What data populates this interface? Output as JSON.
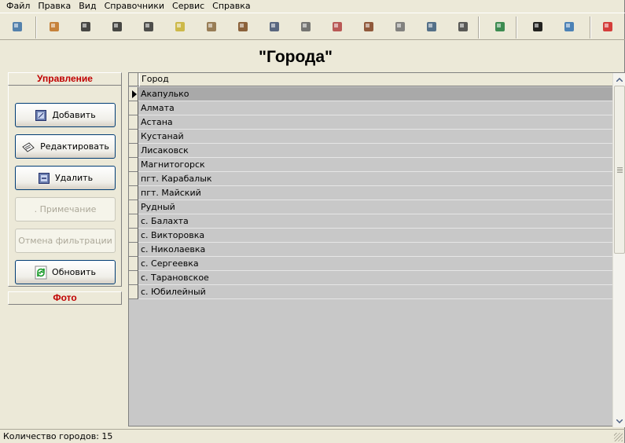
{
  "menu": [
    "Файл",
    "Правка",
    "Вид",
    "Справочники",
    "Сервис",
    "Справка"
  ],
  "toolbar": {
    "buttons": [
      {
        "name": "exit-icon",
        "color": "#3a6ea5"
      },
      {
        "name": "image-icon",
        "color": "#c07020"
      },
      {
        "name": "users-icon",
        "color": "#2a2a2a"
      },
      {
        "name": "person-edit-icon",
        "color": "#2a2a2a"
      },
      {
        "name": "person-list-icon",
        "color": "#333"
      },
      {
        "name": "folder-icon",
        "color": "#c8b030"
      },
      {
        "name": "documents-icon",
        "color": "#8a6a40"
      },
      {
        "name": "bag-icon",
        "color": "#7a4a20"
      },
      {
        "name": "pen-icon",
        "color": "#405070"
      },
      {
        "name": "pin-icon",
        "color": "#606060"
      },
      {
        "name": "people-icon",
        "color": "#b04040"
      },
      {
        "name": "ruler-icon",
        "color": "#804020"
      },
      {
        "name": "tree-icon",
        "color": "#707070"
      },
      {
        "name": "building-icon",
        "color": "#3a5a7a"
      },
      {
        "name": "hat-icon",
        "color": "#404040"
      },
      {
        "name": "excel-icon",
        "color": "#1e7a3a"
      },
      {
        "name": "binoculars-icon",
        "color": "#000"
      },
      {
        "name": "magnifier-icon",
        "color": "#3070b0"
      },
      {
        "name": "back-arrows-icon",
        "color": "#d02020"
      }
    ]
  },
  "page_title": "\"Города\"",
  "controls": {
    "header": "Управление",
    "buttons": [
      {
        "label": "Добавить",
        "icon": "add-icon",
        "enabled": true
      },
      {
        "label": "Редактировать",
        "icon": "edit-icon",
        "enabled": true
      },
      {
        "label": "Удалить",
        "icon": "delete-icon",
        "enabled": true
      },
      {
        "label": ". Примечание",
        "icon": "",
        "enabled": false
      },
      {
        "label": "Отмена фильтрации",
        "icon": "",
        "enabled": false
      },
      {
        "label": "Обновить",
        "icon": "refresh-icon",
        "enabled": true
      }
    ]
  },
  "photo": {
    "header": "Фото"
  },
  "grid": {
    "column": "Город",
    "rows": [
      "Акапулько",
      "Алмата",
      "Астана",
      "Кустанай",
      "Лисаковск",
      "Магнитогорск",
      "пгт. Карабалык",
      "пгт. Майский",
      "Рудный",
      "с. Балахта",
      "с. Викторовка",
      "с. Николаевка",
      "с. Сергеевка",
      "с. Тарановское",
      "с. Юбилейный"
    ],
    "selected_index": 0
  },
  "status": {
    "text": "Количество городов: 15"
  },
  "colors": {
    "accent_red": "#c00000",
    "selected_row": "#a9a9a9",
    "grid_bg": "#c8c8c8"
  }
}
